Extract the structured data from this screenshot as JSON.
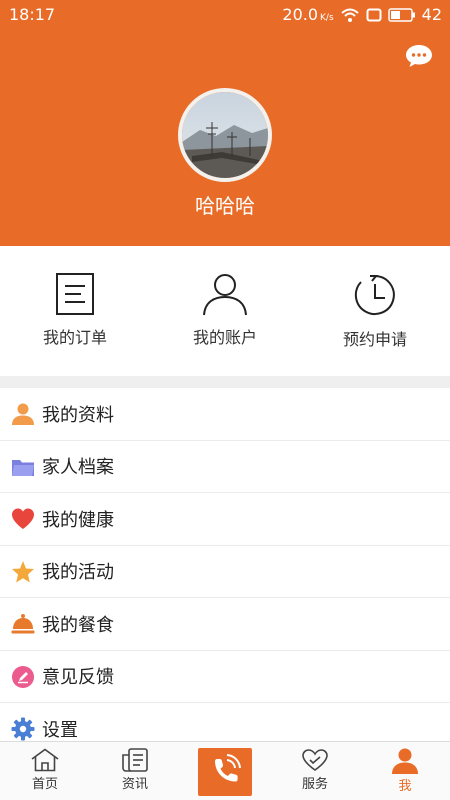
{
  "status_bar": {
    "time": "18:17",
    "speed": "20.0",
    "speed_unit": "K/s",
    "battery": "42"
  },
  "profile": {
    "username": "哈哈哈"
  },
  "quick_actions": [
    {
      "label": "我的订单",
      "icon": "order-list-icon"
    },
    {
      "label": "我的账户",
      "icon": "user-account-icon"
    },
    {
      "label": "预约申请",
      "icon": "clock-refresh-icon"
    }
  ],
  "menu": [
    {
      "label": "我的资料",
      "icon": "person-icon",
      "color": "#f29b4b"
    },
    {
      "label": "家人档案",
      "icon": "folder-icon",
      "color": "#7b7fe0"
    },
    {
      "label": "我的健康",
      "icon": "heart-icon",
      "color": "#e8453c"
    },
    {
      "label": "我的活动",
      "icon": "star-icon",
      "color": "#f3a83b"
    },
    {
      "label": "我的餐食",
      "icon": "dish-cover-icon",
      "color": "#e87a2e"
    },
    {
      "label": "意见反馈",
      "icon": "pencil-icon",
      "color": "#ec5a8e"
    },
    {
      "label": "设置",
      "icon": "gear-icon",
      "color": "#4a7fd6"
    }
  ],
  "tabbar": {
    "tabs": [
      {
        "label": "首页",
        "icon": "home-icon"
      },
      {
        "label": "资讯",
        "icon": "news-icon"
      },
      {
        "label": "",
        "icon": "phone-icon"
      },
      {
        "label": "服务",
        "icon": "heart-hands-icon"
      },
      {
        "label": "我",
        "icon": "me-icon"
      }
    ],
    "active_index": 4
  },
  "colors": {
    "accent": "#e86c28",
    "tab_active": "#e86c28"
  }
}
